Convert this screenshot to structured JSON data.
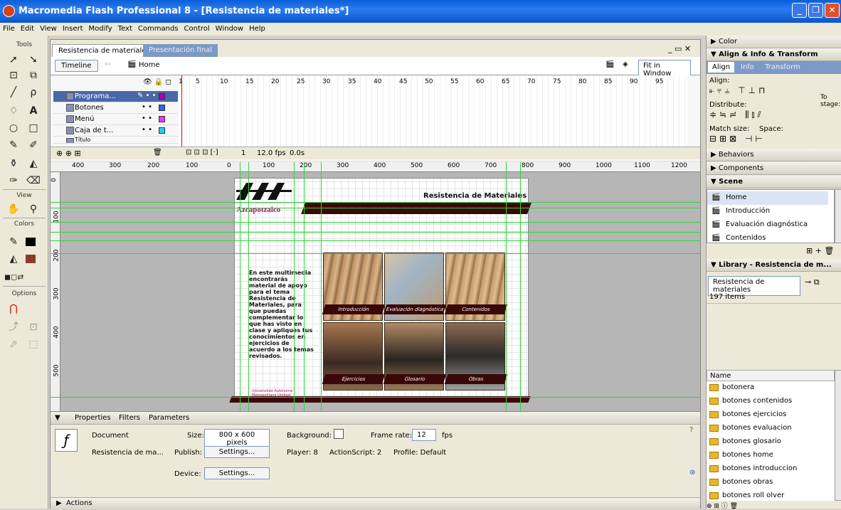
{
  "window": {
    "title": "Macromedia Flash Professional 8 - [Resistencia de materiales*]"
  },
  "menu": [
    "File",
    "Edit",
    "View",
    "Insert",
    "Modify",
    "Text",
    "Commands",
    "Control",
    "Window",
    "Help"
  ],
  "tools": {
    "label": "Tools",
    "view_label": "View",
    "colors_label": "Colors",
    "options_label": "Options"
  },
  "tabs": {
    "active": "Resistencia de materiales*",
    "inactive": "Presentación final"
  },
  "editbar": {
    "timeline_button": "Timeline",
    "scene": "Home",
    "zoom": "Fit in Window"
  },
  "layers": [
    {
      "name": "Programa...",
      "color": "#b000b0"
    },
    {
      "name": "Botones",
      "color": "#3060ff"
    },
    {
      "name": "Menú",
      "color": "#ff30ff"
    },
    {
      "name": "Caja de t...",
      "color": "#20d0ff"
    },
    {
      "name": "Título",
      "color": "#ff3030"
    }
  ],
  "frame_numbers": [
    "1",
    "5",
    "10",
    "15",
    "20",
    "25",
    "30",
    "35",
    "40",
    "45",
    "50",
    "55",
    "60",
    "65",
    "70",
    "75",
    "80",
    "85",
    "90",
    "95"
  ],
  "timeline_status": {
    "frame": "1",
    "fps": "12.0 fps",
    "time": "0.0s"
  },
  "ruler_h": [
    "400",
    "300",
    "200",
    "100",
    "0",
    "100",
    "200",
    "300",
    "400",
    "500",
    "600",
    "700",
    "800",
    "900",
    "1000",
    "1100",
    "1200"
  ],
  "ruler_v": [
    "0",
    "100",
    "200",
    "300",
    "400",
    "500"
  ],
  "stage": {
    "header": "Resistencia de Materiales",
    "logo_text": "Azcapotzalco",
    "intro": "En este multimedia encontrarás material de apoyo para el tema Resistencia de Materiales, para que puedas complementar lo que has visto en clase y apliques tus conocimientos en ejercicios de acuerdo a los temas revisados.",
    "footer": "Universidad Autónoma Metropolitana Unidad Azcapotzalco 2007",
    "tiles": [
      "Introducción",
      "Evaluación diagnóstica",
      "Contenidos",
      "Ejercicios",
      "Glosario",
      "Obras"
    ]
  },
  "properties": {
    "tabs": [
      "Properties",
      "Filters",
      "Parameters"
    ],
    "doc_label": "Document",
    "doc_name": "Resistencia de ma...",
    "size_label": "Size:",
    "size_value": "800 x 600 pixels",
    "background_label": "Background:",
    "framerate_label": "Frame rate:",
    "framerate_value": "12",
    "fps": "fps",
    "publish_label": "Publish:",
    "settings": "Settings...",
    "player": "Player: 8",
    "actionscript": "ActionScript: 2",
    "profile": "Profile: Default",
    "device_label": "Device:"
  },
  "actions_label": "Actions",
  "right": {
    "color": "Color",
    "align_title": "Align & Info & Transform",
    "align_tabs": [
      "Align",
      "Info",
      "Transform"
    ],
    "align_label": "Align:",
    "distribute_label": "Distribute:",
    "match_label": "Match size:",
    "space_label": "Space:",
    "to_stage": "To stage:",
    "behaviors": "Behaviors",
    "components": "Components",
    "scene": "Scene",
    "scenes": [
      "Home",
      "Introducción",
      "Evaluación diagnóstica",
      "Contenidos"
    ],
    "library_title": "Library - Resistencia de m...",
    "library_select": "Resistencia de materiales",
    "library_count": "197 items",
    "name_col": "Name",
    "library_items": [
      "botonera",
      "botones contenidos",
      "botones ejercicios",
      "botones evaluacion",
      "botones glosario",
      "botones home",
      "botones introduccion",
      "botones obras",
      "botones roll olver"
    ]
  },
  "colors": {
    "titlebar": "#0a5fd8",
    "guide": "#35d23e",
    "banner": "#3a0808"
  }
}
